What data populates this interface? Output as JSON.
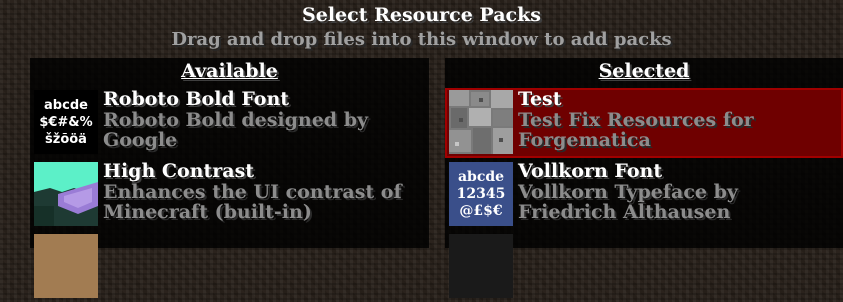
{
  "screen": {
    "title": "Select Resource Packs",
    "subtitle": "Drag and drop files into this window to add packs"
  },
  "available": {
    "header": "Available",
    "packs": [
      {
        "name": "Roboto Bold Font",
        "desc_line1": "Roboto Bold designed by",
        "desc_line2": "Google",
        "icon": "font-preview-icon",
        "icon_lines": [
          "abcde",
          "$€#&%",
          "šžõöä"
        ]
      },
      {
        "name": "High Contrast",
        "desc_line1": "Enhances the UI contrast of",
        "desc_line2": "Minecraft (built-in)",
        "icon": "high-contrast-icon",
        "icon_lines": []
      }
    ]
  },
  "selected": {
    "header": "Selected",
    "packs": [
      {
        "name": "Test",
        "desc_line1": "Test Fix Resources for",
        "desc_line2": "Forgematica",
        "icon": "cobblestone-icon",
        "icon_lines": []
      },
      {
        "name": "Vollkorn Font",
        "desc_line1": "Vollkorn Typeface by",
        "desc_line2": "Friedrich Althausen",
        "icon": "font-preview-icon",
        "icon_lines": [
          "abcde",
          "12345",
          "@£$€"
        ]
      }
    ]
  },
  "colors": {
    "selected_bg": "#6f0000",
    "selected_border": "#a00000",
    "title": "#ffffff",
    "subtitle": "#a0a0a0",
    "description": "#8c8c8c"
  }
}
